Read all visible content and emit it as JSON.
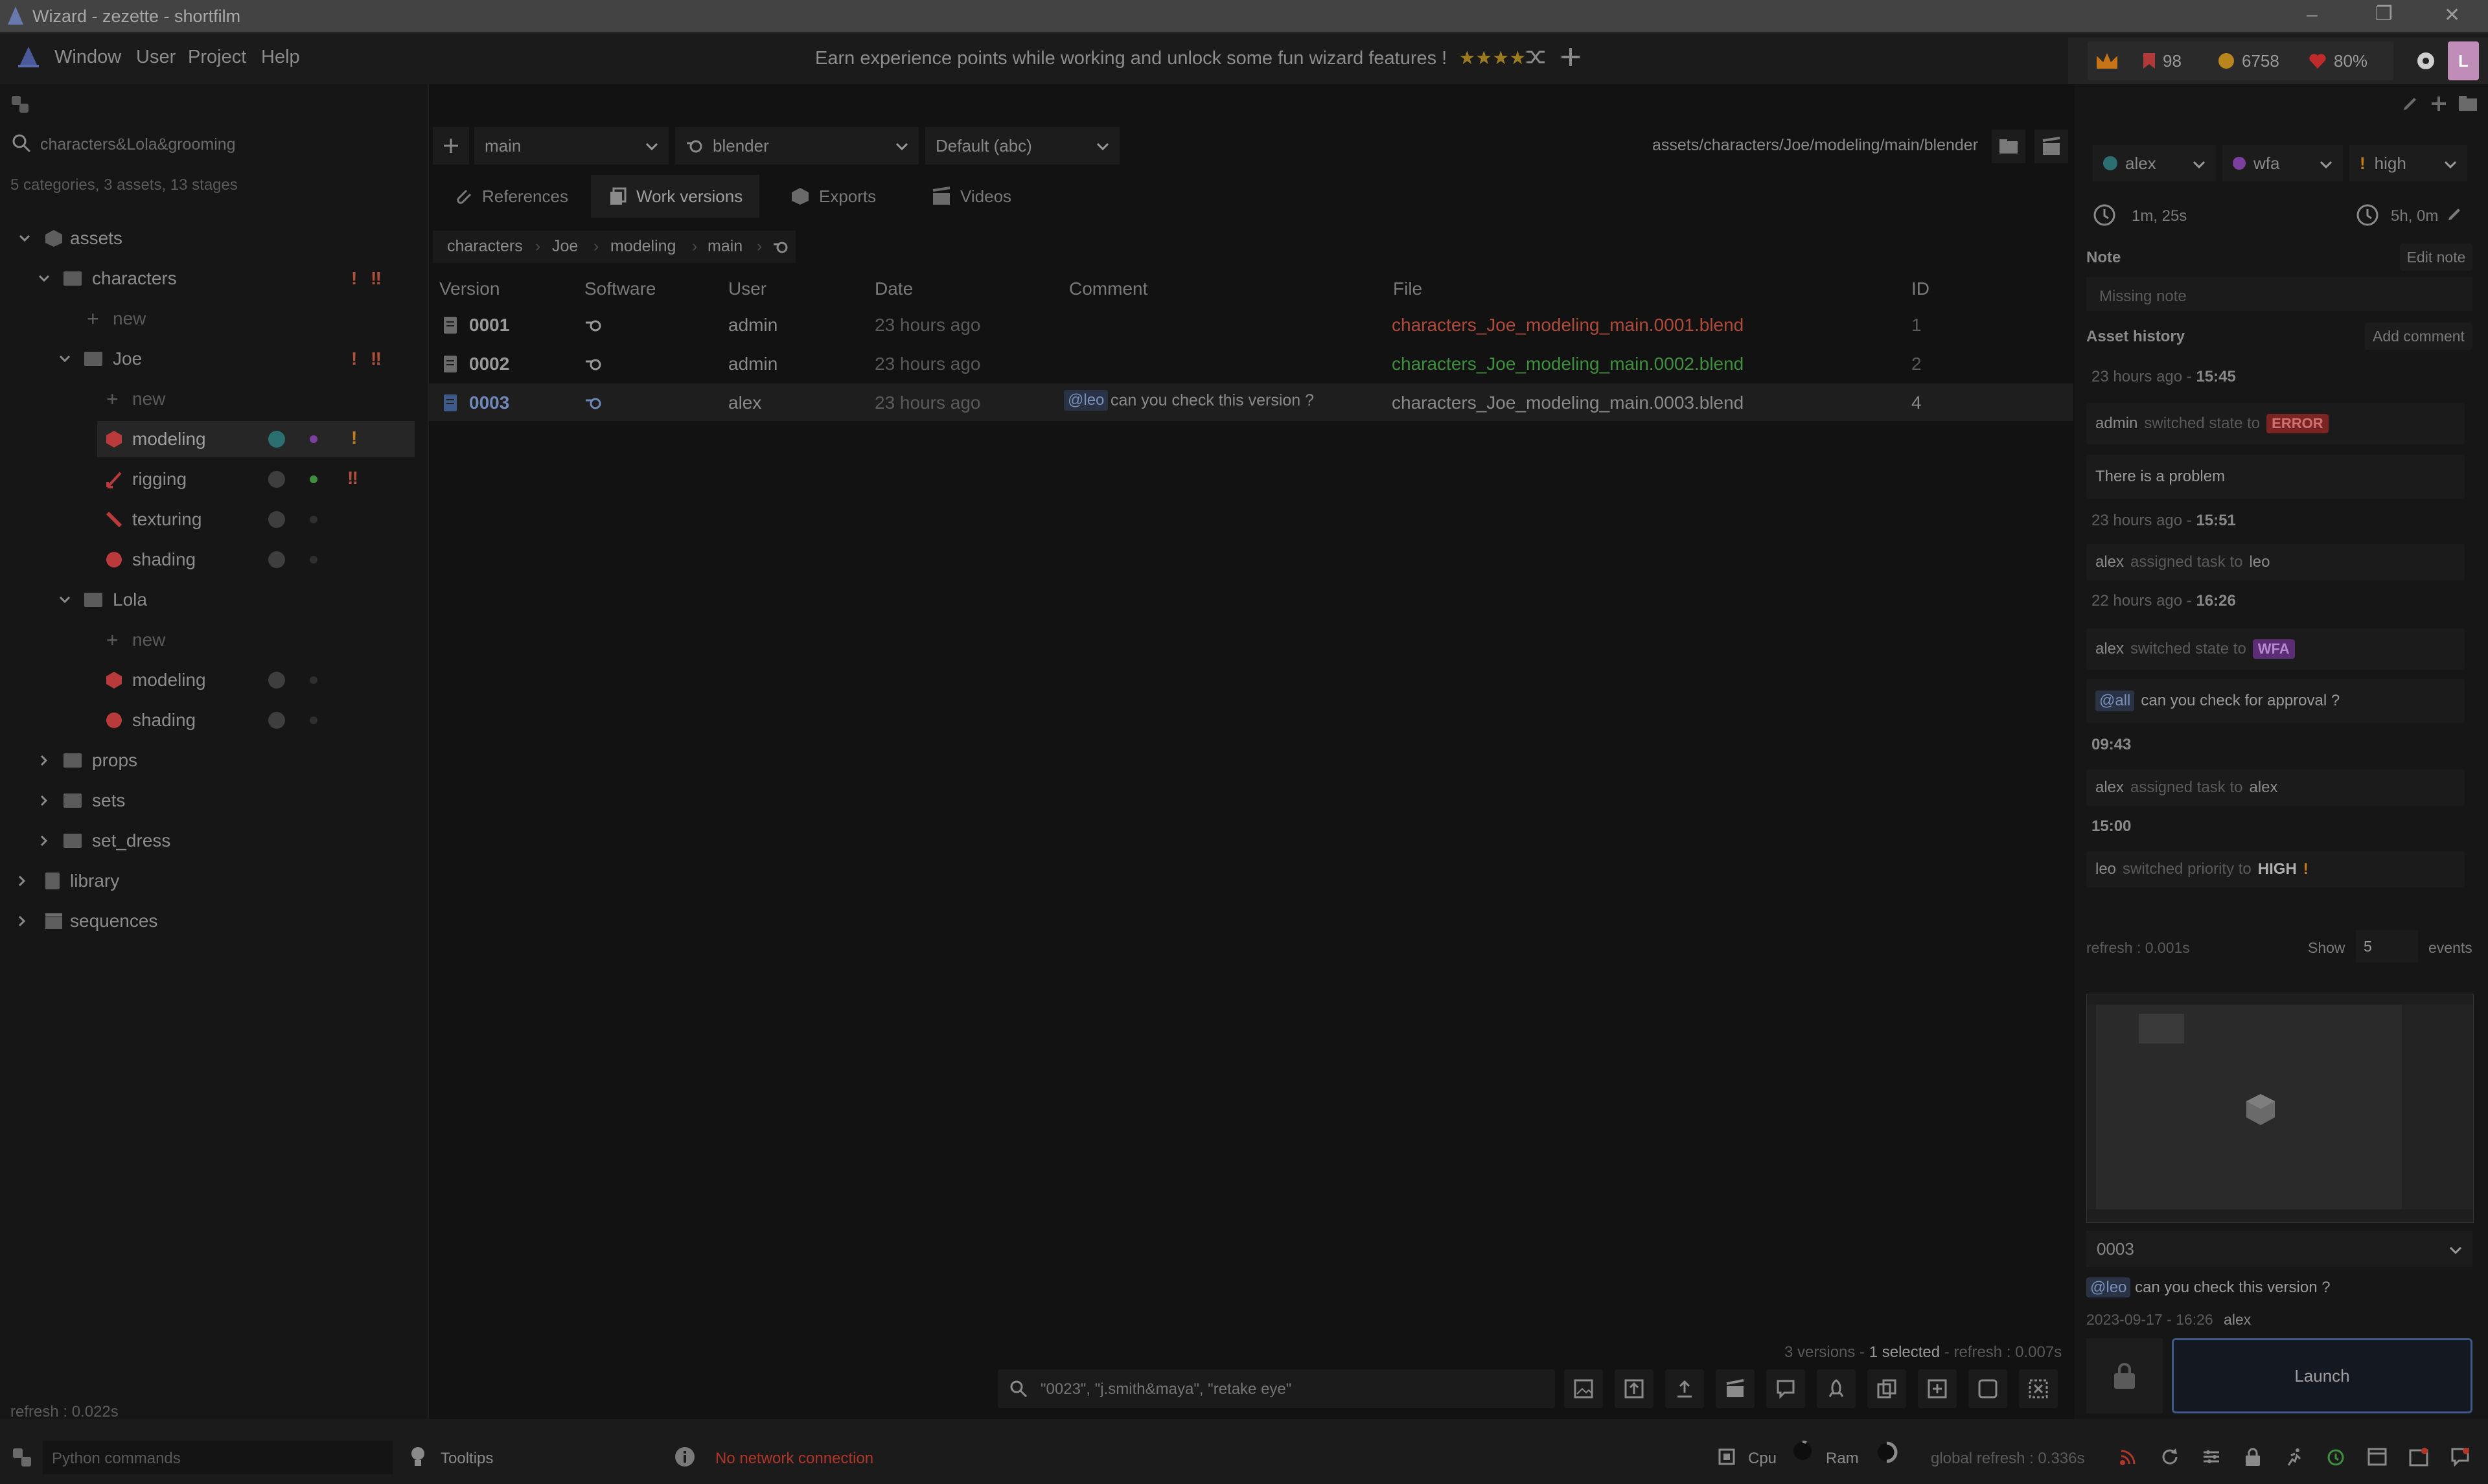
{
  "titlebar": {
    "title": "Wizard - zezette - shortfilm"
  },
  "menu": {
    "items": [
      "Window",
      "User",
      "Project",
      "Help"
    ]
  },
  "banner": {
    "text": "Earn experience points while working and unlock some fun wizard features !",
    "stars": "★★★★"
  },
  "stats": {
    "bookmarks": "98",
    "coins": "6758",
    "health": "80%",
    "avatar": "L"
  },
  "left": {
    "search_value": "characters&Lola&grooming",
    "summary": "5 categories, 3 assets, 13 stages",
    "tree": [
      {
        "label": "assets"
      },
      {
        "label": "characters"
      },
      {
        "label": "new"
      },
      {
        "label": "Joe"
      },
      {
        "label": "new"
      },
      {
        "label": "modeling"
      },
      {
        "label": "rigging"
      },
      {
        "label": "texturing"
      },
      {
        "label": "shading"
      },
      {
        "label": "Lola"
      },
      {
        "label": "new"
      },
      {
        "label": "modeling"
      },
      {
        "label": "shading"
      },
      {
        "label": "props"
      },
      {
        "label": "sets"
      },
      {
        "label": "set_dress"
      },
      {
        "label": "library"
      },
      {
        "label": "sequences"
      }
    ],
    "refresh": "refresh : 0.022s"
  },
  "center": {
    "variant": "main",
    "software": "blender",
    "export_format": "Default (abc)",
    "path": "assets/characters/Joe/modeling/main/blender",
    "tabs": [
      "References",
      "Work versions",
      "Exports",
      "Videos"
    ],
    "breadcrumb": [
      "characters",
      "Joe",
      "modeling",
      "main"
    ],
    "columns": [
      "Version",
      "Software",
      "User",
      "Date",
      "Comment",
      "File",
      "ID"
    ],
    "rows": [
      {
        "version": "0001",
        "user": "admin",
        "date": "23 hours ago",
        "mention": "",
        "comment": "",
        "file": "characters_Joe_modeling_main.0001.blend",
        "id": "1"
      },
      {
        "version": "0002",
        "user": "admin",
        "date": "23 hours ago",
        "mention": "",
        "comment": "",
        "file": "characters_Joe_modeling_main.0002.blend",
        "id": "2"
      },
      {
        "version": "0003",
        "user": "alex",
        "date": "23 hours ago",
        "mention": "@leo",
        "comment": "can you check this version ?",
        "file": "characters_Joe_modeling_main.0003.blend",
        "id": "4"
      }
    ],
    "footer_versions": "3 versions - ",
    "footer_selected": "1 selected",
    "footer_refresh": " - refresh : 0.007s",
    "search_placeholder": "\"0023\", \"j.smith&maya\", \"retake eye\""
  },
  "right": {
    "assignee": "alex",
    "state": "wfa",
    "priority": "high",
    "time_spent": "1m, 25s",
    "estimate": "5h, 0m",
    "note_label": "Note",
    "edit_note": "Edit note",
    "note_value": "Missing note",
    "history_label": "Asset history",
    "add_comment": "Add comment",
    "history": {
      "t1_ago": "23 hours ago - ",
      "t1": "15:45",
      "e1_user": "admin",
      "e1_text": "switched state to",
      "e1_tag": "ERROR",
      "c1": "There is a problem",
      "t2_ago": "23 hours ago - ",
      "t2": "15:51",
      "e2_user": "alex",
      "e2_text": "assigned task to",
      "e2_target": "leo",
      "t3_ago": "22 hours ago - ",
      "t3": "16:26",
      "e3_user": "alex",
      "e3_text": "switched state to",
      "e3_tag": "WFA",
      "c2_mention": "@all",
      "c2": "can you check for approval ?",
      "t4": "09:43",
      "e4_user": "alex",
      "e4_text": "assigned task to",
      "e4_target": "alex",
      "t5": "15:00",
      "e5_user": "leo",
      "e5_text": "switched priority to",
      "e5_tag": "HIGH"
    },
    "refresh": "refresh : 0.001s",
    "show_label": "Show",
    "show_value": "5",
    "events_label": "events",
    "version_select": "0003",
    "version_mention": "@leo",
    "version_comment": "can you check this version ?",
    "version_date": "2023-09-17 - 16:26",
    "version_user": "alex",
    "launch": "Launch"
  },
  "statusbar": {
    "python_placeholder": "Python commands",
    "tooltips": "Tooltips",
    "network": "No network connection",
    "cpu": "Cpu",
    "ram": "Ram",
    "global_refresh": "global refresh : 0.336s"
  },
  "colors": {
    "error": "#c0392b",
    "ok": "#3e8f3e",
    "wfa": "#7b3fa0",
    "accent_blue": "#3d5a8a",
    "warning": "#c77d17"
  }
}
